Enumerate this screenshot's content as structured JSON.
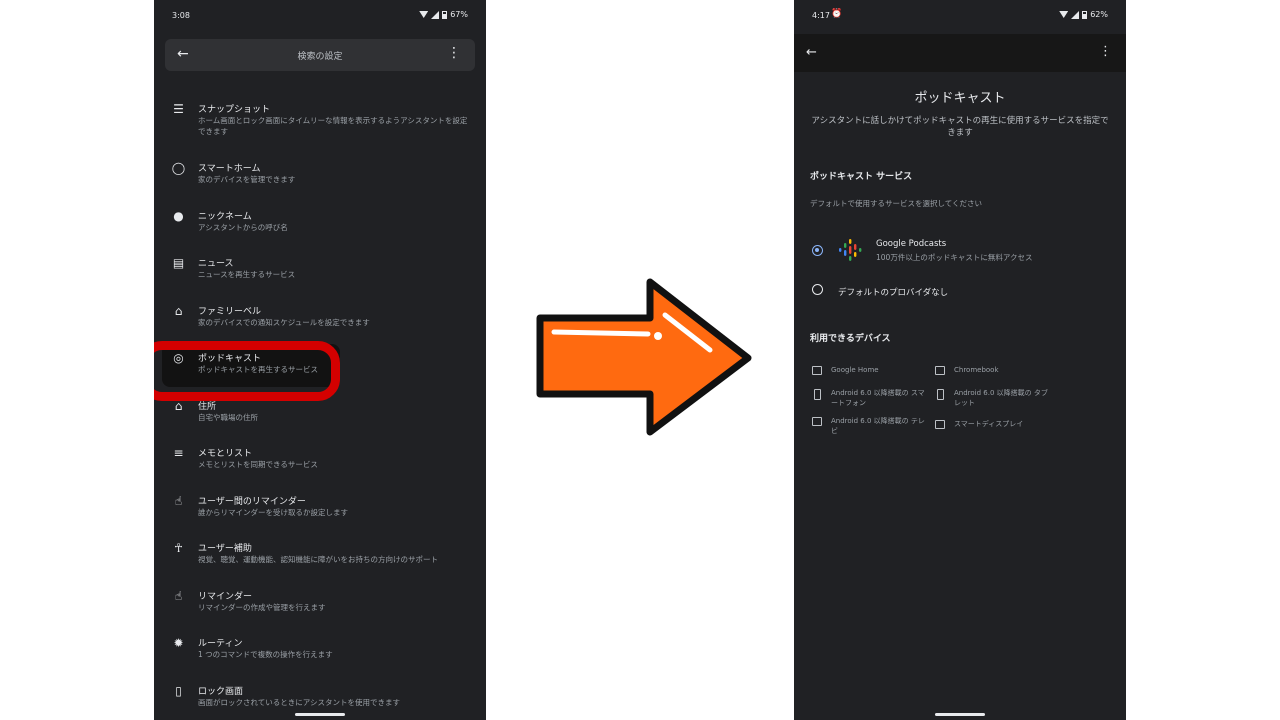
{
  "left": {
    "status": {
      "time": "3:08",
      "battery": "67%"
    },
    "header": {
      "title": "検索の設定",
      "back_icon": "arrow-back-icon",
      "more_icon": "more-vert-icon"
    },
    "items": [
      {
        "title": "スナップショット",
        "sub": "ホーム画面とロック画面にタイムリーな情報を表示するようアシスタントを設定できます",
        "icon": "snapshot-icon"
      },
      {
        "title": "スマートホーム",
        "sub": "家のデバイスを管理できます",
        "icon": "lightbulb-icon"
      },
      {
        "title": "ニックネーム",
        "sub": "アシスタントからの呼び名",
        "icon": "person-icon"
      },
      {
        "title": "ニュース",
        "sub": "ニュースを再生するサービス",
        "icon": "news-icon"
      },
      {
        "title": "ファミリーベル",
        "sub": "家のデバイスでの通知スケジュールを設定できます",
        "icon": "family-bell-icon"
      },
      {
        "title": "ポッドキャスト",
        "sub": "ポッドキャストを再生するサービス",
        "icon": "podcast-icon"
      },
      {
        "title": "住所",
        "sub": "自宅や職場の住所",
        "icon": "home-icon"
      },
      {
        "title": "メモとリスト",
        "sub": "メモとリストを同期できるサービス",
        "icon": "list-icon"
      },
      {
        "title": "ユーザー間のリマインダー",
        "sub": "誰からリマインダーを受け取るか設定します",
        "icon": "touch-icon"
      },
      {
        "title": "ユーザー補助",
        "sub": "視覚、聴覚、運動機能、認知機能に障がいをお持ちの方向けのサポート",
        "icon": "accessibility-icon"
      },
      {
        "title": "リマインダー",
        "sub": "リマインダーの作成や管理を行えます",
        "icon": "touch-icon"
      },
      {
        "title": "ルーティン",
        "sub": "1 つのコマンドで複数の操作を行えます",
        "icon": "routine-icon"
      },
      {
        "title": "ロック画面",
        "sub": "画面がロックされているときにアシスタントを使用できます",
        "icon": "lock-screen-icon"
      }
    ]
  },
  "right": {
    "status": {
      "time": "4:17",
      "battery": "62%"
    },
    "title": "ポッドキャスト",
    "description": "アシスタントに話しかけてポッドキャストの再生に使用するサービスを指定できます",
    "service_section": "ポッドキャスト サービス",
    "service_hint": "デフォルトで使用するサービスを選択してください",
    "options": [
      {
        "name": "Google Podcasts",
        "sub": "100万件以上のポッドキャストに無料アクセス",
        "selected": true
      },
      {
        "name": "デフォルトのプロバイダなし",
        "selected": false
      }
    ],
    "devices_section": "利用できるデバイス",
    "devices": [
      {
        "label": "Google Home",
        "icon": "speaker-icon"
      },
      {
        "label": "Chromebook",
        "icon": "laptop-icon"
      },
      {
        "label": "Android 6.0 以降搭載の スマートフォン",
        "icon": "smartphone-icon"
      },
      {
        "label": "Android 6.0 以降搭載の タブレット",
        "icon": "tablet-icon"
      },
      {
        "label": "Android 6.0 以降搭載の テレビ",
        "icon": "tv-icon"
      },
      {
        "label": "スマートディスプレイ",
        "icon": "smart-display-icon"
      }
    ]
  },
  "colors": {
    "highlight": "#d40000",
    "arrow": "#ff6a10",
    "radio_selected": "#8ab4f8"
  }
}
